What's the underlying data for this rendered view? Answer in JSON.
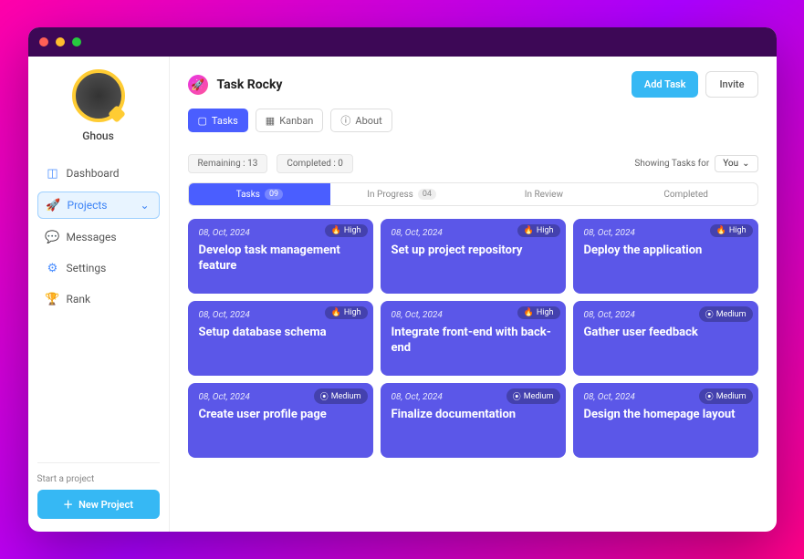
{
  "user": {
    "name": "Ghous"
  },
  "nav": {
    "dashboard": "Dashboard",
    "projects": "Projects",
    "messages": "Messages",
    "settings": "Settings",
    "rank": "Rank"
  },
  "sidebar": {
    "startLabel": "Start a project",
    "newProjectLabel": "New Project"
  },
  "header": {
    "appTitle": "Task Rocky",
    "addTask": "Add Task",
    "invite": "Invite"
  },
  "viewTabs": {
    "tasks": "Tasks",
    "kanban": "Kanban",
    "about": "About"
  },
  "stats": {
    "remainingLabel": "Remaining :",
    "remainingCount": "13",
    "completedLabel": "Completed :",
    "completedCount": "0",
    "showingLabel": "Showing Tasks for",
    "you": "You"
  },
  "statusTabs": {
    "tasks": {
      "label": "Tasks",
      "count": "09"
    },
    "inProgress": {
      "label": "In Progress",
      "count": "04"
    },
    "inReview": {
      "label": "In Review"
    },
    "completed": {
      "label": "Completed"
    }
  },
  "priorities": {
    "high": "High",
    "medium": "Medium"
  },
  "cards": [
    {
      "date": "08, Oct, 2024",
      "title": "Develop task management feature",
      "priority": "high"
    },
    {
      "date": "08, Oct, 2024",
      "title": "Set up project repository",
      "priority": "high"
    },
    {
      "date": "08, Oct, 2024",
      "title": "Deploy the application",
      "priority": "high"
    },
    {
      "date": "08, Oct, 2024",
      "title": "Setup database schema",
      "priority": "high"
    },
    {
      "date": "08, Oct, 2024",
      "title": "Integrate front-end with back-end",
      "priority": "high"
    },
    {
      "date": "08, Oct, 2024",
      "title": "Gather user feedback",
      "priority": "medium"
    },
    {
      "date": "08, Oct, 2024",
      "title": "Create user profile page",
      "priority": "medium"
    },
    {
      "date": "08, Oct, 2024",
      "title": "Finalize documentation",
      "priority": "medium"
    },
    {
      "date": "08, Oct, 2024",
      "title": "Design the homepage layout",
      "priority": "medium"
    }
  ]
}
